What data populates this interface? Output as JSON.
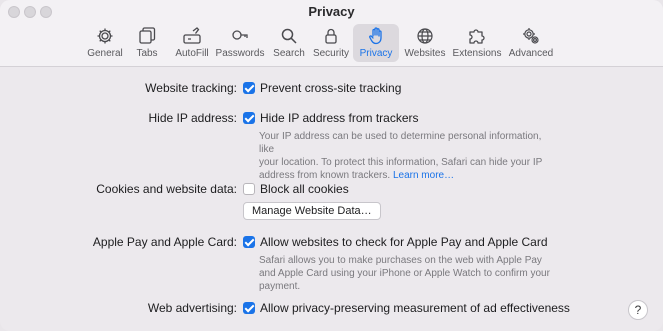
{
  "window": {
    "title": "Privacy"
  },
  "toolbar": {
    "tabs": [
      {
        "label": "General",
        "icon": "gear-icon"
      },
      {
        "label": "Tabs",
        "icon": "tabs-icon"
      },
      {
        "label": "AutoFill",
        "icon": "autofill-icon"
      },
      {
        "label": "Passwords",
        "icon": "key-icon"
      },
      {
        "label": "Search",
        "icon": "search-icon"
      },
      {
        "label": "Security",
        "icon": "lock-icon"
      },
      {
        "label": "Privacy",
        "icon": "hand-icon",
        "active": true
      },
      {
        "label": "Websites",
        "icon": "globe-icon"
      },
      {
        "label": "Extensions",
        "icon": "puzzle-icon"
      },
      {
        "label": "Advanced",
        "icon": "gears-icon"
      }
    ]
  },
  "settings": {
    "tracking": {
      "label": "Website tracking:",
      "option": "Prevent cross-site tracking",
      "checked": true
    },
    "hide_ip": {
      "label": "Hide IP address:",
      "option": "Hide IP address from trackers",
      "checked": true,
      "help_line1": "Your IP address can be used to determine personal information, like",
      "help_line2": "your location. To protect this information, Safari can hide your IP",
      "help_line3": "address from known trackers.",
      "help_link": "Learn more…"
    },
    "cookies": {
      "label": "Cookies and website data:",
      "option": "Block all cookies",
      "checked": false,
      "button": "Manage Website Data…"
    },
    "apple_pay": {
      "label": "Apple Pay and Apple Card:",
      "option": "Allow websites to check for Apple Pay and Apple Card",
      "checked": true,
      "help_line1": "Safari allows you to make purchases on the web with Apple Pay",
      "help_line2": "and Apple Card using your iPhone or Apple Watch to confirm your",
      "help_line3": "payment."
    },
    "advertising": {
      "label": "Web advertising:",
      "option": "Allow privacy-preserving measurement of ad effectiveness",
      "checked": true
    }
  },
  "help_button": {
    "label": "?"
  },
  "colors": {
    "accent": "#1a73e8",
    "help_text": "#7a797e"
  }
}
